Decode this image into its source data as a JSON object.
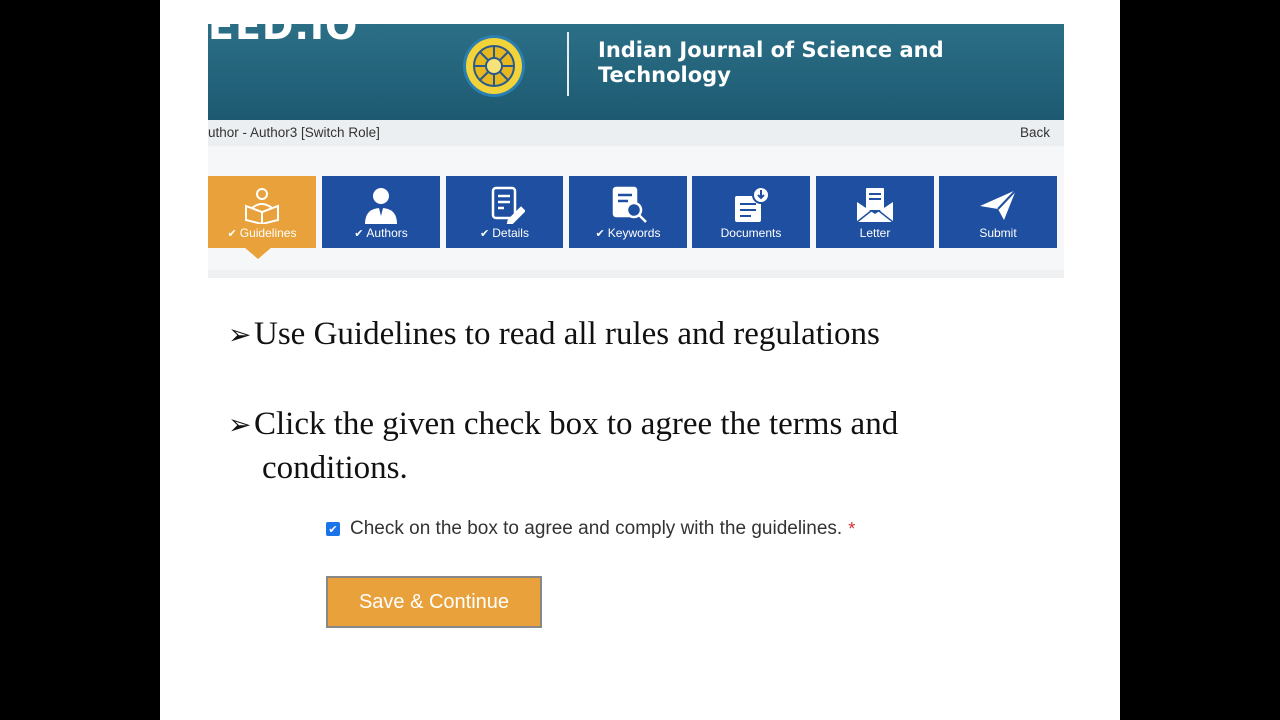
{
  "brand": {
    "text": "EED.IO"
  },
  "header": {
    "title": "Indian Journal of Science and Technology"
  },
  "rolebar": {
    "role": "uthor - Author3 [Switch Role]",
    "back": "Back"
  },
  "steps": [
    {
      "label": "Guidelines",
      "checked": true,
      "icon": "reading-person-icon",
      "active": true
    },
    {
      "label": "Authors",
      "checked": true,
      "icon": "user-icon",
      "active": false
    },
    {
      "label": "Details",
      "checked": true,
      "icon": "document-edit-icon",
      "active": false
    },
    {
      "label": "Keywords",
      "checked": true,
      "icon": "search-document-icon",
      "active": false
    },
    {
      "label": "Documents",
      "checked": false,
      "icon": "documents-download-icon",
      "active": false
    },
    {
      "label": "Letter",
      "checked": false,
      "icon": "envelope-letter-icon",
      "active": false
    },
    {
      "label": "Submit",
      "checked": false,
      "icon": "paper-plane-icon",
      "active": false
    }
  ],
  "bullets": {
    "arrow": "➢",
    "b1": "Use Guidelines to read all rules and regulations",
    "b2_line1": "Click the given check box to agree the terms and",
    "b2_line2": "conditions."
  },
  "agreement": {
    "label": "Check on the box to agree and comply with the guidelines.",
    "required": "*",
    "checked": true
  },
  "save_button": {
    "label": "Save & Continue"
  },
  "colors": {
    "active_step": "#e9a23b",
    "step": "#1f4fa0",
    "header": "#1d5a72"
  }
}
